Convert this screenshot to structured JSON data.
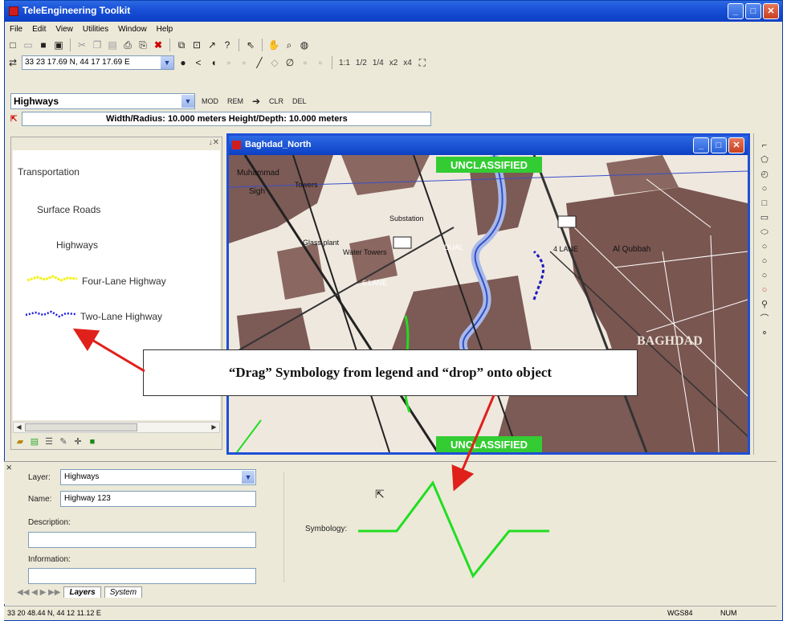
{
  "app": {
    "title": "TeleEngineering Toolkit",
    "menu": [
      "File",
      "Edit",
      "View",
      "Utilities",
      "Window",
      "Help"
    ]
  },
  "toolbar": {
    "coordinate": "33 23 17.69 N, 44 17 17.69 E",
    "zoom_labels": [
      "1:1",
      "1/2",
      "1/4",
      "x2",
      "x4"
    ]
  },
  "layer_bar": {
    "selected_layer": "Highways",
    "buttons": [
      "MOD",
      "REM",
      "CLR",
      "DEL"
    ]
  },
  "dimension_bar": {
    "text": "Width/Radius: 10.000 meters Height/Depth: 10.000 meters"
  },
  "legend": {
    "items": [
      {
        "label": "Transportation"
      },
      {
        "label": "Surface Roads"
      },
      {
        "label": "Highways"
      },
      {
        "label": "Four-Lane Highway",
        "color": "#f2f21a"
      },
      {
        "label": "Two-Lane Highway",
        "color": "#1a1ae0"
      }
    ]
  },
  "map": {
    "window_title": "Baghdad_North",
    "classification_top": "UNCLASSIFIED",
    "classification_bottom": "UNCLASSIFIED",
    "labels": [
      "Towers",
      "Glass plant",
      "Water Towers",
      "Substation",
      "Al Qubbah",
      "BAGHDAD",
      "DUAL",
      "6 LANE",
      "4 LANE"
    ]
  },
  "properties": {
    "layer_label": "Layer:",
    "layer_value": "Highways",
    "name_label": "Name:",
    "name_value": "Highway 123",
    "description_label": "Description:",
    "information_label": "Information:",
    "symbology_label": "Symbology:",
    "symbology_color": "#22dd22"
  },
  "tabs": [
    "Layers",
    "System"
  ],
  "status": {
    "coordinates": "33 20 48.44 N, 44 12 11.12 E",
    "datum": "WGS84",
    "num": "NUM"
  },
  "callout": {
    "text": "“Drag” Symbology from legend and “drop” onto object"
  },
  "colors": {
    "titlebar": "#1951d8",
    "arrow": "#e0201a",
    "highway_green": "#22dd22",
    "unclassified_bg": "#33cc33"
  }
}
